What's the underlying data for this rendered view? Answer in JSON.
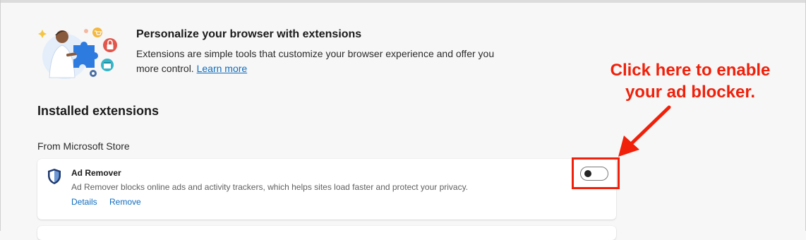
{
  "banner": {
    "title": "Personalize your browser with extensions",
    "description": "Extensions are simple tools that customize your browser experience and offer you more control.",
    "learn_more": "Learn more"
  },
  "installed": {
    "heading": "Installed extensions",
    "source_heading": "From Microsoft Store"
  },
  "extension": {
    "name": "Ad Remover",
    "description": "Ad Remover blocks online ads and activity trackers, which helps sites load faster and protect your privacy.",
    "details_label": "Details",
    "remove_label": "Remove",
    "enabled": false,
    "icon": "shield-icon"
  },
  "annotation": {
    "line1": "Click here to enable",
    "line2": "your ad blocker.",
    "color": "#f0200a"
  },
  "colors": {
    "link": "#0f6cbd",
    "background": "#f7f7f7"
  }
}
